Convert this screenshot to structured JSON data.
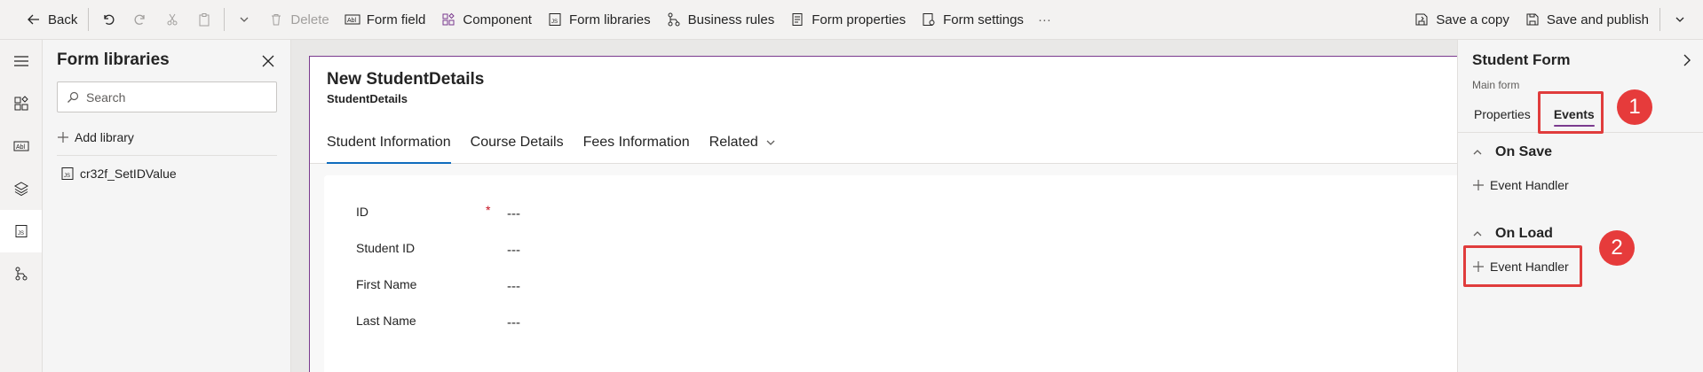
{
  "toolbar": {
    "back": "Back",
    "delete": "Delete",
    "form_field": "Form field",
    "component": "Component",
    "form_libraries": "Form libraries",
    "business_rules": "Business rules",
    "form_properties": "Form properties",
    "form_settings": "Form settings",
    "more": "···",
    "save_copy": "Save a copy",
    "save_publish": "Save and publish"
  },
  "libraries": {
    "title": "Form libraries",
    "search_placeholder": "Search",
    "add_library": "Add library",
    "items": [
      "cr32f_SetIDValue"
    ]
  },
  "form": {
    "title": "New StudentDetails",
    "entity": "StudentDetails",
    "tabs": [
      "Student Information",
      "Course Details",
      "Fees Information",
      "Related"
    ],
    "selected_tab": "Student Information",
    "fields": [
      {
        "label": "ID",
        "required": "*",
        "value": "---"
      },
      {
        "label": "Student ID",
        "value": "---"
      },
      {
        "label": "First Name",
        "value": "---"
      },
      {
        "label": "Last Name",
        "value": "---"
      }
    ]
  },
  "properties": {
    "title": "Student Form",
    "subtitle": "Main form",
    "tabs": [
      "Properties",
      "Events"
    ],
    "selected_tab": "Events",
    "on_save": {
      "heading": "On Save",
      "handler": "Event Handler"
    },
    "on_load": {
      "heading": "On Load",
      "handler": "Event Handler"
    }
  },
  "annotations": {
    "one": "1",
    "two": "2"
  },
  "colors": {
    "accent_tab": "#0f6cbd",
    "accent_purple": "#7a3a8e",
    "callout_red": "#e63b3b"
  }
}
